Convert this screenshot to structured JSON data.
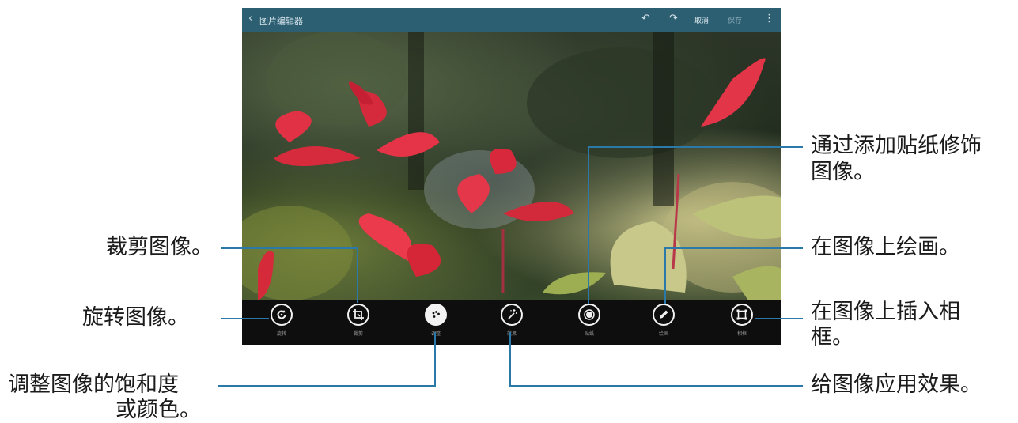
{
  "app": {
    "title": "图片编辑器",
    "back_glyph": "‹",
    "actions": {
      "undo_glyph": "↶",
      "redo_glyph": "↷",
      "cancel_label": "取消",
      "save_label": "保存",
      "more_glyph": "⋮"
    }
  },
  "toolbar": {
    "tools": [
      {
        "name": "rotate",
        "label": "旋转"
      },
      {
        "name": "crop",
        "label": "裁剪"
      },
      {
        "name": "color",
        "label": "调整"
      },
      {
        "name": "effect",
        "label": "效果"
      },
      {
        "name": "sticker",
        "label": "贴纸"
      },
      {
        "name": "drawing",
        "label": "绘画"
      },
      {
        "name": "frame",
        "label": "相框"
      }
    ]
  },
  "callouts": {
    "crop": "裁剪图像。",
    "rotate": "旋转图像。",
    "color_line1": "调整图像的饱和度",
    "color_line2": "或颜色。",
    "sticker_line1": "通过添加贴纸修饰",
    "sticker_line2": "图像。",
    "drawing": "在图像上绘画。",
    "frame_line1": "在图像上插入相",
    "frame_line2": "框。",
    "effect": "给图像应用效果。"
  },
  "colors": {
    "actionbar": "#2d5f73",
    "callout_line": "#2b79a8",
    "toolbar": "#0e0e0e"
  }
}
